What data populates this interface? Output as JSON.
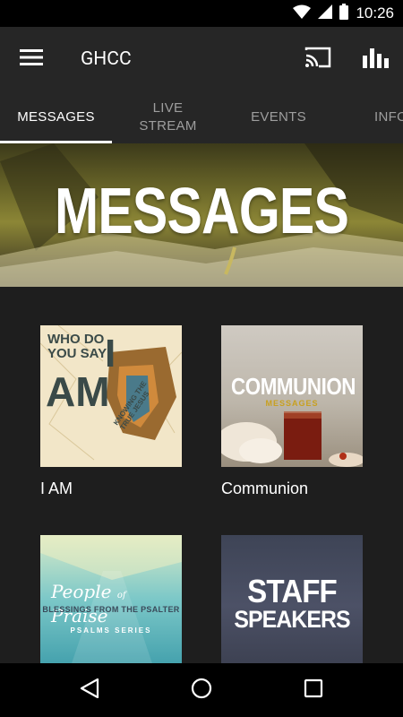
{
  "status_bar": {
    "time": "10:26",
    "icons": [
      "wifi-icon",
      "signal-icon",
      "battery-icon"
    ]
  },
  "app_bar": {
    "title": "GHCC",
    "icons": [
      "menu-icon",
      "cast-icon",
      "bar-chart-icon"
    ]
  },
  "tabs": [
    {
      "label": "MESSAGES",
      "active": true
    },
    {
      "label": "LIVE\nSTREAM",
      "active": false
    },
    {
      "label": "EVENTS",
      "active": false
    },
    {
      "label": "INFO",
      "active": false
    }
  ],
  "banner": {
    "title": "MESSAGES"
  },
  "cards": [
    {
      "label": "I AM",
      "art_text": [
        "WHO DO",
        "YOU SAY",
        "I",
        "AM",
        "KNOWING THE TRUE JESUS"
      ]
    },
    {
      "label": "Communion",
      "art_text": [
        "COMMUNION",
        "MESSAGES"
      ]
    },
    {
      "label": "",
      "art_text": [
        "People",
        "of",
        "Praise",
        "BLESSINGS FROM THE PSALTER",
        "PSALMS SERIES"
      ]
    },
    {
      "label": "",
      "art_text": [
        "STAFF",
        "SPEAKERS"
      ]
    }
  ],
  "nav_bar": {
    "icons": [
      "back-icon",
      "home-icon",
      "recents-icon"
    ]
  },
  "colors": {
    "background": "#1e1e1e",
    "app_bar": "#262626",
    "status_bar": "#000000",
    "tab_inactive": "#9e9e9e"
  }
}
